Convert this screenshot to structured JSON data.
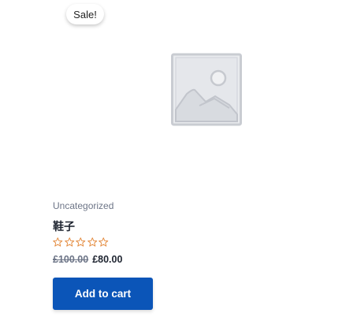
{
  "product": {
    "badge": "Sale!",
    "category": "Uncategorized",
    "title": "鞋子",
    "rating": {
      "value": 0,
      "max": 5,
      "icon": "star-outline-icon"
    },
    "price_old": "£100.00",
    "price_new": "£80.00",
    "add_to_cart_label": "Add to cart",
    "image_icon": "image-placeholder-icon"
  },
  "colors": {
    "accent": "#0b55b8",
    "star": "#e3883a",
    "muted_text": "#6d7587",
    "text": "#1e2430",
    "placeholder": "#c9ccd2"
  }
}
